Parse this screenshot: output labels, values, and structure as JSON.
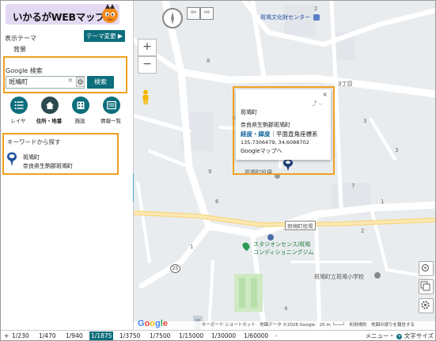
{
  "app": {
    "logo_text": "いかるがWEBマップ"
  },
  "sidebar": {
    "theme_label": "表示テーマ",
    "theme_button": "テーマ変更",
    "theme_value": "背景",
    "search_label": "Google 検索",
    "search_value": "斑鳩町",
    "search_button": "検索",
    "tools": [
      {
        "label": "レイヤ",
        "icon": "layer-list-icon"
      },
      {
        "label": "住所・地番",
        "icon": "house-icon"
      },
      {
        "label": "施設",
        "icon": "building-icon"
      },
      {
        "label": "情報一覧",
        "icon": "info-list-icon"
      }
    ],
    "keyword_title": "キーワードから探す",
    "keyword_result_line1": "斑鳩町",
    "keyword_result_line2": "奈良県生駒郡斑鳩町",
    "collapse_label": "«"
  },
  "map": {
    "labels": {
      "culture_center": "斑鳩文化財センター",
      "sansan_chome": "3丁目",
      "town_hall_near": "斑鳩町役場",
      "town_hall_sign": "斑鳩町役場",
      "stadium_l1": "スタジオンセンス/斑鳩",
      "stadium_l2": "コンディショニングジム",
      "school": "斑鳩町立斑鳩小学校",
      "route": "25"
    },
    "numbers": [
      "8",
      "2",
      "5",
      "9",
      "6",
      "7",
      "1",
      "2",
      "4",
      "3",
      "1",
      "3"
    ],
    "popup": {
      "title": "斑鳩町",
      "address": "奈良県生駒郡斑鳩町",
      "reference_bold": "経度・緯度",
      "reference_rest": "｜平面直角座標系",
      "coords": "135.7306479, 34.6088702",
      "google_link": "Googleマップへ",
      "close": "×"
    },
    "attribution": "キーボード ショートカット　地図データ ©2026 Google　20 m └───┘　利用規約　地図の誤りを報告する",
    "google_logo": "Google"
  },
  "scalebar": {
    "items": [
      "1/230",
      "1/470",
      "1/940",
      "1/1875",
      "1/3750",
      "1/7500",
      "1/15000",
      "1/30000",
      "1/60000"
    ],
    "active": "1/1875",
    "plus": "+",
    "minus": "-",
    "menu": "メニュー・",
    "font_size": "文字サイズ"
  },
  "colors": {
    "accent": "#0d6e7c",
    "highlight": "#f0a020",
    "collapse": "#3db0bc"
  }
}
